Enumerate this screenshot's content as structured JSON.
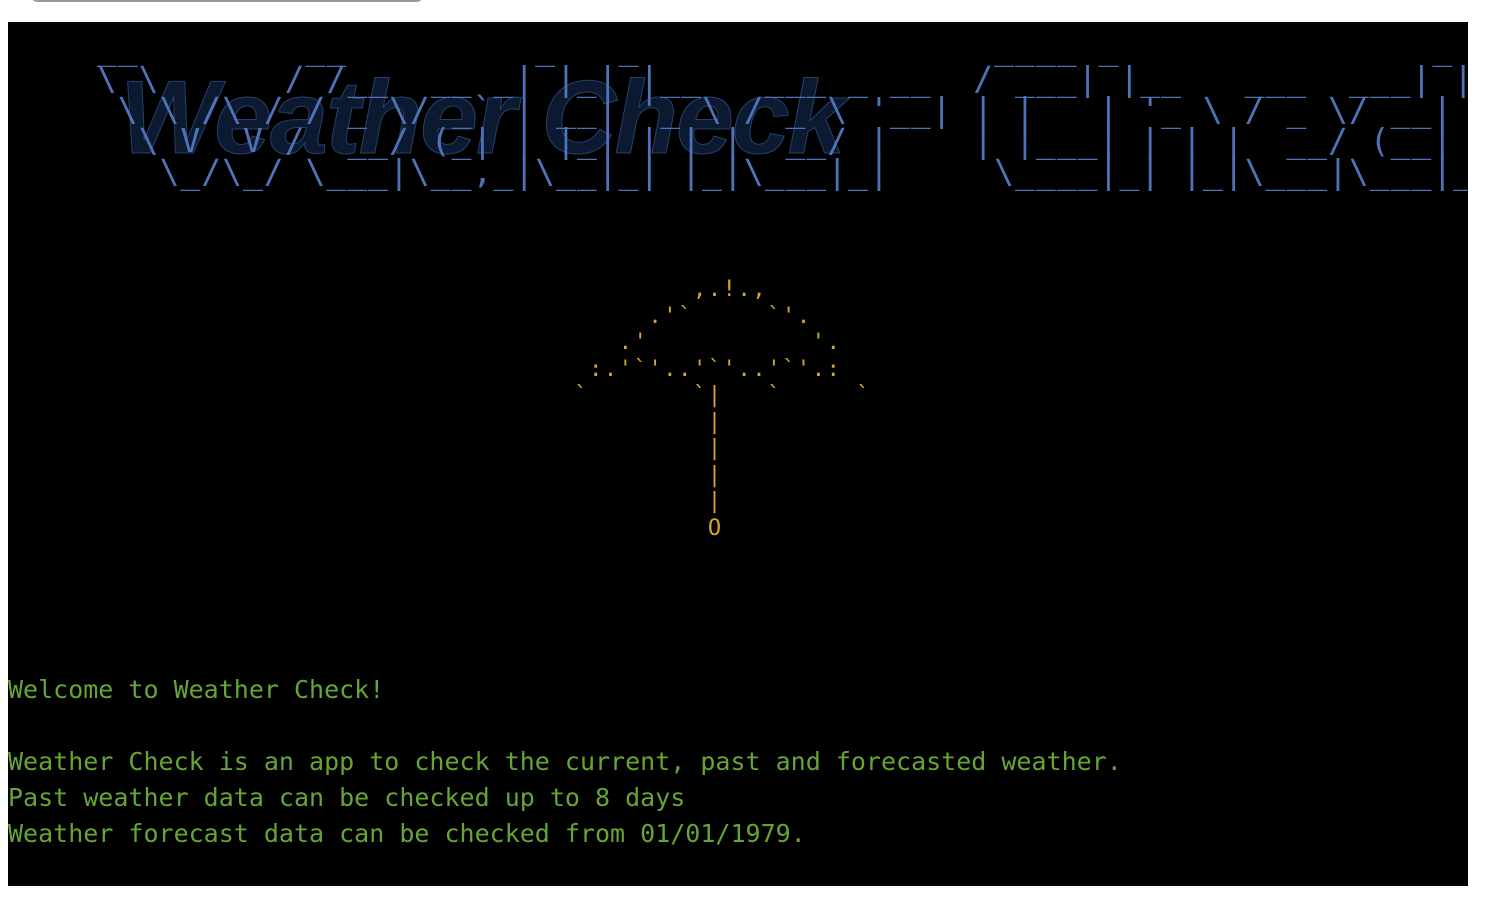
{
  "window": {
    "background": "#000000",
    "tab_color": "#e6e6e6"
  },
  "banner": {
    "shadow_text": "Weather Check",
    "ascii_art": " __        __         _   _                 ____ _               _    \n \\ \\      / /__  __ _| |_| |__   ___ _ __  / ___| |__   ___  ___| | __\n  \\ \\ /\\ / / _ \\/ _` | __| '_ \\ / _ \\ '__| | |   | '_ \\ / _ \\/ __| |/ /\n   \\ V  V /  __/ (_| | |_| | | |  __/ |    | |___| | | |  __/ (__|   < \n    \\_/\\_/ \\___|\\__,_|\\__|_| |_|\\___|_|     \\____|_| |_|\\___|\\___|_|\\_\\",
    "color": "#4f73b8"
  },
  "umbrella": {
    "ascii_art": "             ,.!.,\n          .'`     `'.\n        .'           '.\n      :.'`'..'`'..'`'.:\n     `       `|   `     `\n              |\n              |\n              |\n              |\n              O",
    "color": "#d6a72e"
  },
  "console": {
    "lines": [
      "Welcome to Weather Check!",
      "",
      "Weather Check is an app to check the current, past and forecasted weather.",
      "Past weather data can be checked up to 8 days",
      "Weather forecast data can be checked from 01/01/1979."
    ],
    "color": "#66a534"
  }
}
